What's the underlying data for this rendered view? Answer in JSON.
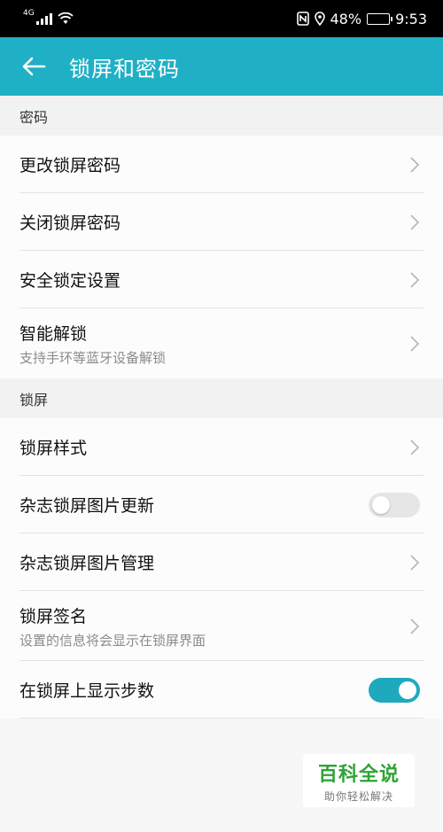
{
  "status_bar": {
    "network": "4G",
    "battery": "48%",
    "battery_level": 0.48,
    "time": "9:53",
    "icons": [
      "signal-icon",
      "wifi-icon",
      "nfc-icon",
      "location-icon",
      "battery-icon"
    ]
  },
  "app_bar": {
    "title": "锁屏和密码",
    "back_icon": "arrow-left-icon"
  },
  "sections": {
    "password": {
      "header": "密码",
      "items": [
        {
          "title": "更改锁屏密码"
        },
        {
          "title": "关闭锁屏密码"
        },
        {
          "title": "安全锁定设置"
        },
        {
          "title": "智能解锁",
          "subtitle": "支持手环等蓝牙设备解锁"
        }
      ]
    },
    "lockscreen": {
      "header": "锁屏",
      "items": [
        {
          "title": "锁屏样式"
        },
        {
          "title": "杂志锁屏图片更新",
          "toggle": false
        },
        {
          "title": "杂志锁屏图片管理"
        },
        {
          "title": "锁屏签名",
          "subtitle": "设置的信息将会显示在锁屏界面"
        },
        {
          "title": "在锁屏上显示步数",
          "toggle": true
        }
      ]
    }
  },
  "colors": {
    "accent": "#1fb0c5",
    "toggle_on": "#1fa9bd",
    "watermark_green": "#2fa335"
  },
  "watermark": {
    "main": "百科全说",
    "sub": "助你轻松解决"
  }
}
